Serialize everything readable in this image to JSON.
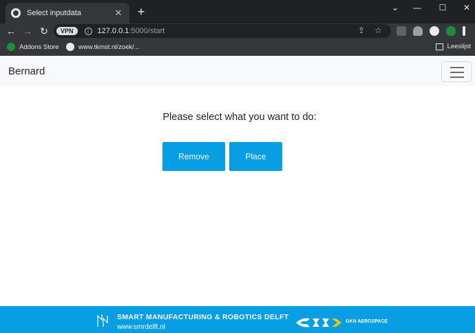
{
  "browser": {
    "tab": {
      "title": "Select inputdata",
      "close_glyph": "✕"
    },
    "new_tab_glyph": "+",
    "window_controls": {
      "minimize": "—",
      "maximize": "☐",
      "close": "✕",
      "menu": "⌄"
    },
    "nav": {
      "back": "←",
      "forward": "→",
      "reload": "↻"
    },
    "omnibox": {
      "vpn_label": "VPN",
      "info_glyph": "i",
      "url_host": "127.0.0.1",
      "url_path": ":5000/start"
    },
    "omni_icons": {
      "share": "⇪",
      "star": "☆"
    },
    "bookmarks": [
      {
        "label": "Addons Store",
        "icon": "addons-store-icon"
      },
      {
        "label": "www.tkmst.nl/zoek/...",
        "icon": "globe-icon"
      }
    ],
    "reading_list": "Leeslijst"
  },
  "page": {
    "navbar": {
      "brand": "Bernard"
    },
    "heading": "Please select what you want to do:",
    "buttons": {
      "remove": "Remove",
      "place": "Place"
    },
    "footer": {
      "title": "SMART MANUFACTURING & ROBOTICS DELFT",
      "url": "www.smrdelft.nl",
      "partner": "GKN AEROSPACE"
    }
  },
  "colors": {
    "accent": "#079ee4",
    "navbar_bg": "#f8f9fa",
    "chrome_dark": "#202124",
    "chrome_mid": "#35363a"
  }
}
